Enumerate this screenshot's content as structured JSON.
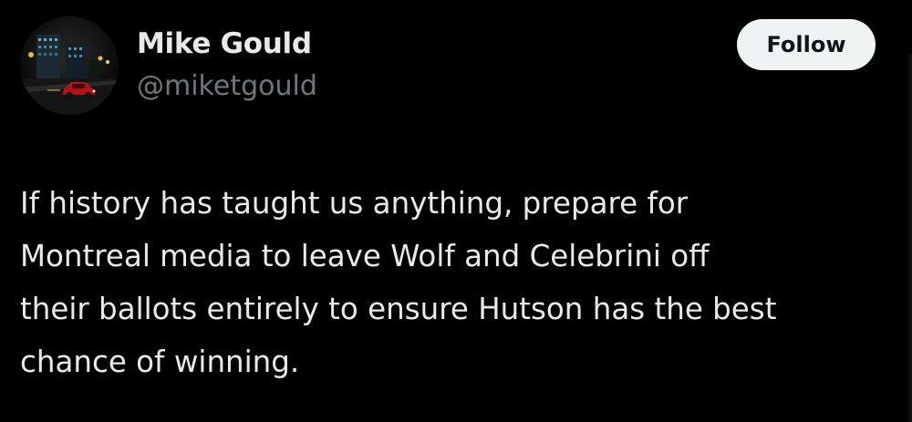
{
  "author": {
    "name": "Mike Gould",
    "handle": "@miketgould"
  },
  "actions": {
    "follow_label": "Follow"
  },
  "tweet": {
    "lines": [
      "If history has taught us anything, prepare for",
      "Montreal media to leave Wolf and Celebrini off",
      "their ballots entirely to ensure Hutson has the best",
      "chance of winning."
    ]
  },
  "colors": {
    "background": "#000000",
    "primary_text": "#e7e9ea",
    "secondary_text": "#71767b",
    "follow_button_bg": "#eff3f4",
    "follow_button_text": "#0f1419"
  },
  "icons": {
    "avatar": "avatar-night-street-photo"
  }
}
